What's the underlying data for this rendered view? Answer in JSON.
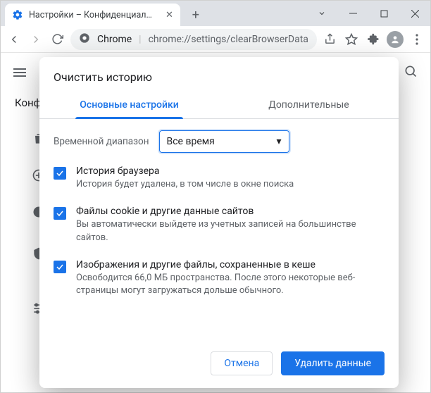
{
  "window": {
    "tab_title": "Настройки – Конфиденциально",
    "url_host": "Chrome",
    "url_path": "chrome://settings/clearBrowserData"
  },
  "background": {
    "section_label": "Конф"
  },
  "modal": {
    "title": "Очистить историю",
    "tabs": {
      "basic": "Основные настройки",
      "advanced": "Дополнительные"
    },
    "time_range": {
      "label": "Временной диапазон",
      "value": "Все время"
    },
    "options": [
      {
        "title": "История браузера",
        "desc": "История будет удалена, в том числе в окне поиска"
      },
      {
        "title": "Файлы cookie и другие данные сайтов",
        "desc": "Вы автоматически выйдете из учетных записей на большинстве сайтов."
      },
      {
        "title": "Изображения и другие файлы, сохраненные в кеше",
        "desc": "Освободится 66,0 МБ пространства. После этого некоторые веб-страницы могут загружаться дольше обычного."
      }
    ],
    "buttons": {
      "cancel": "Отмена",
      "confirm": "Удалить данные"
    }
  }
}
